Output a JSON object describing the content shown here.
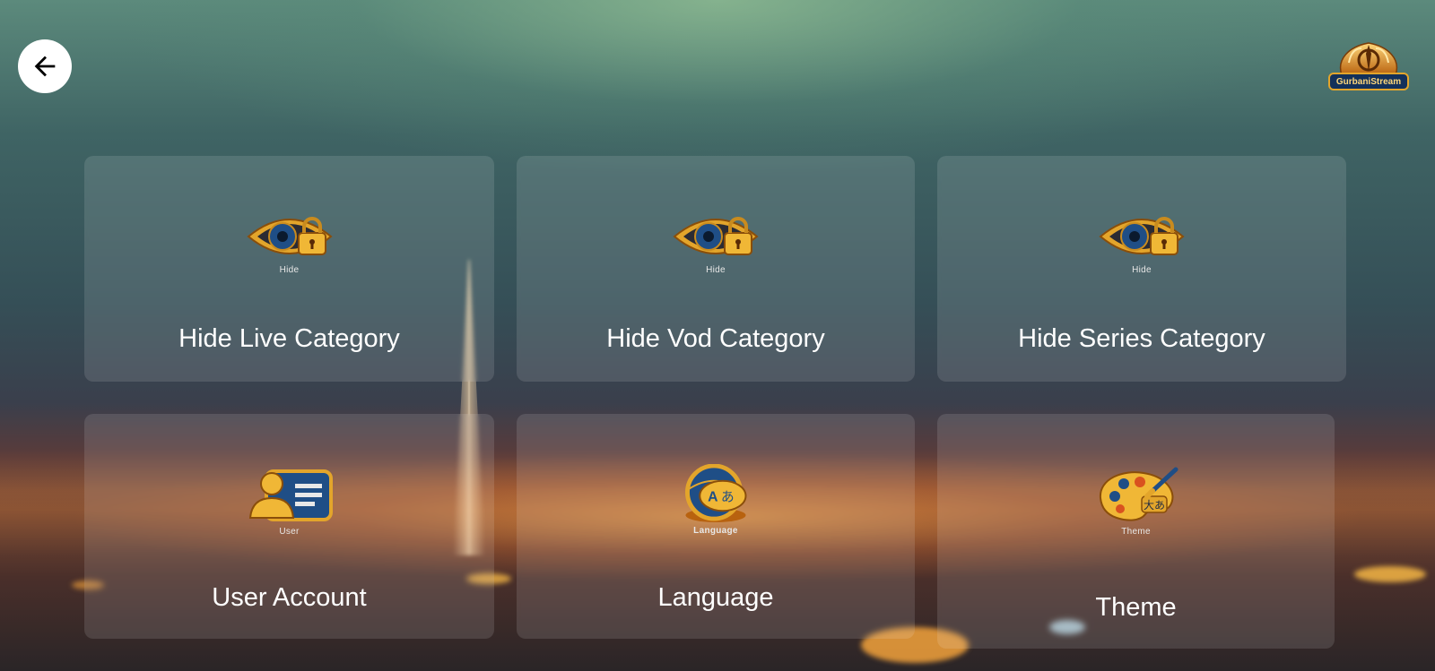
{
  "header": {
    "back_icon": "arrow-left-icon",
    "logo_text": "GurbaniStream"
  },
  "cards": [
    {
      "label": "Hide Live Category",
      "icon": "eye-lock-icon",
      "icon_caption": "Hide"
    },
    {
      "label": "Hide Vod Category",
      "icon": "eye-lock-icon",
      "icon_caption": "Hide"
    },
    {
      "label": "Hide Series Category",
      "icon": "eye-lock-icon",
      "icon_caption": "Hide"
    },
    {
      "label": "User Account",
      "icon": "user-card-icon",
      "icon_caption": "User"
    },
    {
      "label": "Language",
      "icon": "language-globe-icon",
      "icon_caption": "Language"
    },
    {
      "label": "Theme",
      "icon": "palette-icon",
      "icon_caption": "Theme"
    }
  ],
  "colors": {
    "accent_gold": "#e3a52b",
    "card_text": "#ffffff",
    "icon_blue": "#1f4e86"
  }
}
